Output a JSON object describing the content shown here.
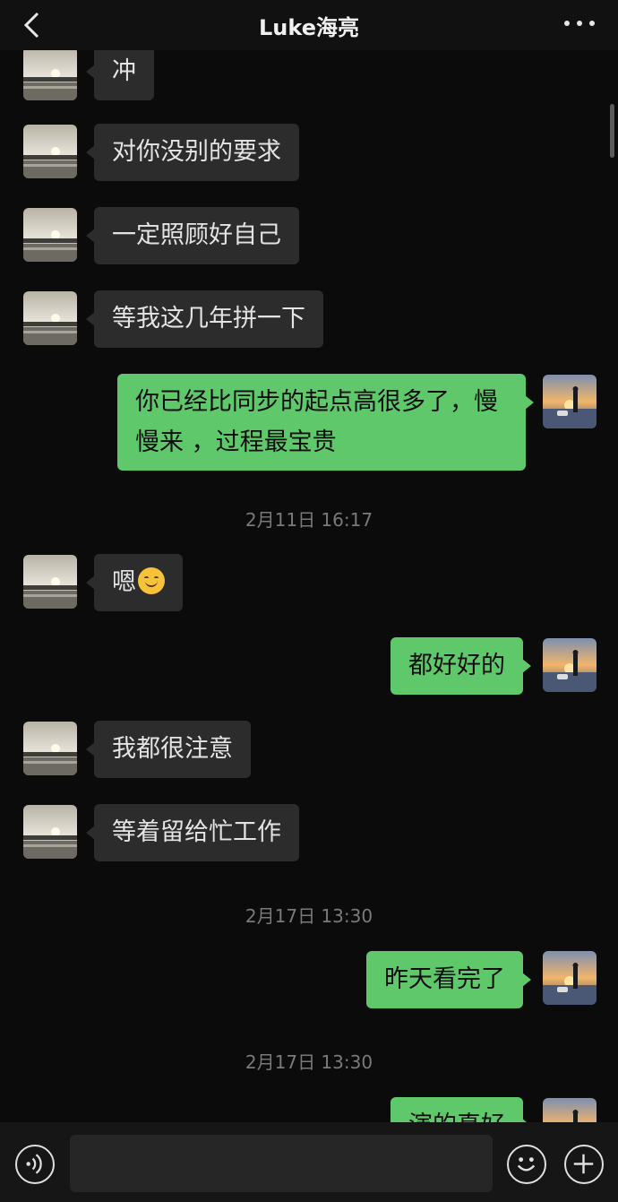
{
  "header": {
    "title": "Luke海亮"
  },
  "messages": [
    {
      "text": "冲"
    },
    {
      "text": "对你没别的要求"
    },
    {
      "text": "一定照顾好自己"
    },
    {
      "text": "等我这几年拼一下"
    },
    {
      "text": "你已经比同步的起点高很多了，慢慢来 ，过程最宝贵"
    },
    {
      "text": "嗯"
    },
    {
      "text": "都好好的"
    },
    {
      "text": "我都很注意"
    },
    {
      "text": "等着留给忙工作"
    },
    {
      "text": "昨天看完了"
    },
    {
      "text": "演的真好"
    }
  ],
  "timestamps": [
    "2月11日 16:17",
    "2月17日 13:30",
    "2月17日 13:30"
  ],
  "icons": {
    "back": "chevron-left-icon",
    "more": "more-dots-icon",
    "voice": "voice-icon",
    "emoji": "emoji-icon",
    "add": "plus-icon",
    "inline_emoji": "smiling-face-emoji"
  },
  "colors": {
    "outgoing_bubble": "#5fc86b",
    "incoming_bubble": "#2c2c2c",
    "background": "#0b0b0b"
  }
}
